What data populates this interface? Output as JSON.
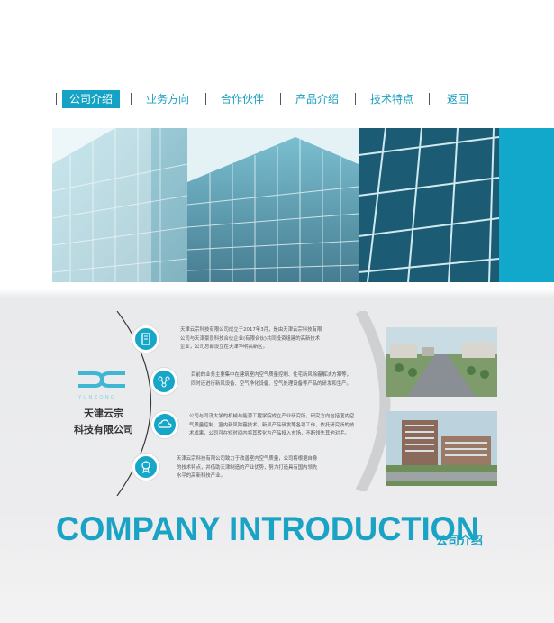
{
  "nav": {
    "items": [
      {
        "label": "公司介绍",
        "active": true
      },
      {
        "label": "业务方向"
      },
      {
        "label": "合作伙伴"
      },
      {
        "label": "产品介绍"
      },
      {
        "label": "技术特点"
      },
      {
        "label": "返回"
      }
    ]
  },
  "company": {
    "logo_text": "YUNZONG",
    "name_line1": "天津云宗",
    "name_line2": "科技有限公司"
  },
  "intro": {
    "paragraphs": [
      {
        "lines": [
          "天津云宗科技有限公司成立于2017年3月，是由天津云宗科技有限",
          "公司与天津豪景科技合伙企业(有限合伙)共同投资组建的高新技术",
          "企业，公司总部设立在天津华明高新区。"
        ]
      },
      {
        "lines": [
          "目前的业务主要集中在建筑室内空气质量控制、住宅新风除霾解决方案等，",
          "同时还进行新风设备、空气净化设备、空气处理设备等产品的研发和生产。"
        ]
      },
      {
        "lines": [
          "公司与同济大学的机械与能源工程学院成立产业研究所，研究方向包括室内空",
          "气质量控制、室内新风除霾技术，新风产品研发等各项工作，依托研究所的技",
          "术成果，公司可在短时间内将其转化为产品投入市场，不断领先其他对手。"
        ]
      },
      {
        "lines": [
          "天津云宗科技有限公司致力于改善室内空气质量，公司将根据自身",
          "的技术特点，并借助天津制造的产业优势，努力打造具有国内领先",
          "水平的高新科技产业。"
        ]
      }
    ]
  },
  "icons": [
    "building-icon",
    "network-icon",
    "cloud-icon",
    "award-icon"
  ],
  "headline": {
    "english": "COMPANY INTRODUCTION",
    "chinese": "公司介绍"
  },
  "colors": {
    "accent": "#14a3c4",
    "text": "#555555"
  }
}
